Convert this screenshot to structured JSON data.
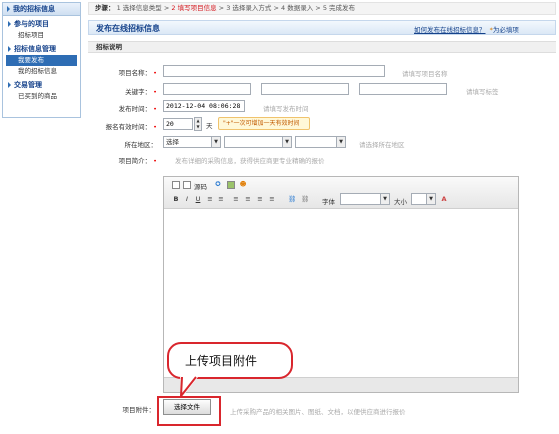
{
  "sidebar": {
    "title": "我的招标信息",
    "groups": [
      {
        "label": "参与的项目",
        "items": [
          {
            "label": "招标项目",
            "active": false
          }
        ]
      },
      {
        "label": "招标信息管理",
        "items": [
          {
            "label": "我要发布",
            "active": true
          },
          {
            "label": "我的招标信息",
            "active": false
          }
        ]
      },
      {
        "label": "交易管理",
        "items": [
          {
            "label": "已买到的商品",
            "active": false
          }
        ]
      }
    ]
  },
  "steps": {
    "prefix": "步骤：",
    "items": [
      "1 选择信息类型",
      "2 填写项目信息",
      "3 选择录入方式",
      "4 数据录入",
      "5 完成发布"
    ],
    "current_index": 1,
    "separator": ">"
  },
  "header": {
    "title": "发布在线招标信息",
    "help_link": "如何发布在线招标信息？",
    "help_suffix": "为必填项"
  },
  "section": {
    "title": "招标说明"
  },
  "form": {
    "project_name": {
      "label": "项目名称：",
      "value": "",
      "hint": "请填写项目名称"
    },
    "keywords": {
      "label": "关键字：",
      "values": [
        "",
        "",
        ""
      ],
      "hint": "请填写标签"
    },
    "publish_time": {
      "label": "发布时间：",
      "value": "2012-12-04 08:06:28",
      "hint": "请填写发布时间"
    },
    "valid_days": {
      "label": "报名有效时间：",
      "value": "20",
      "unit": "天",
      "tooltip": "\"+\"一次可增加一天有效时间"
    },
    "region": {
      "label": "所在地区：",
      "selects": [
        "选择",
        "",
        ""
      ],
      "hint": "请选择所在地区"
    },
    "intro": {
      "label": "项目简介：",
      "hint": "发布详细的采购信息，获得供应商更专业精确的报价"
    },
    "attachment": {
      "label": "项目附件：",
      "button": "选择文件",
      "hint": "上传采购产品的相关图片、图纸、文档，以便供应商进行报价"
    }
  },
  "editor": {
    "row1": [
      "源码"
    ],
    "font_label": "字体",
    "size_label": "大小",
    "bold": "B",
    "italic": "I",
    "underline": "U"
  },
  "callout": {
    "text": "上传项目附件"
  },
  "colors": {
    "accent": "#15428b",
    "active": "#2e6db4",
    "required": "#e00000",
    "callout_border": "#d9262d",
    "current_step": "#d4151b"
  }
}
